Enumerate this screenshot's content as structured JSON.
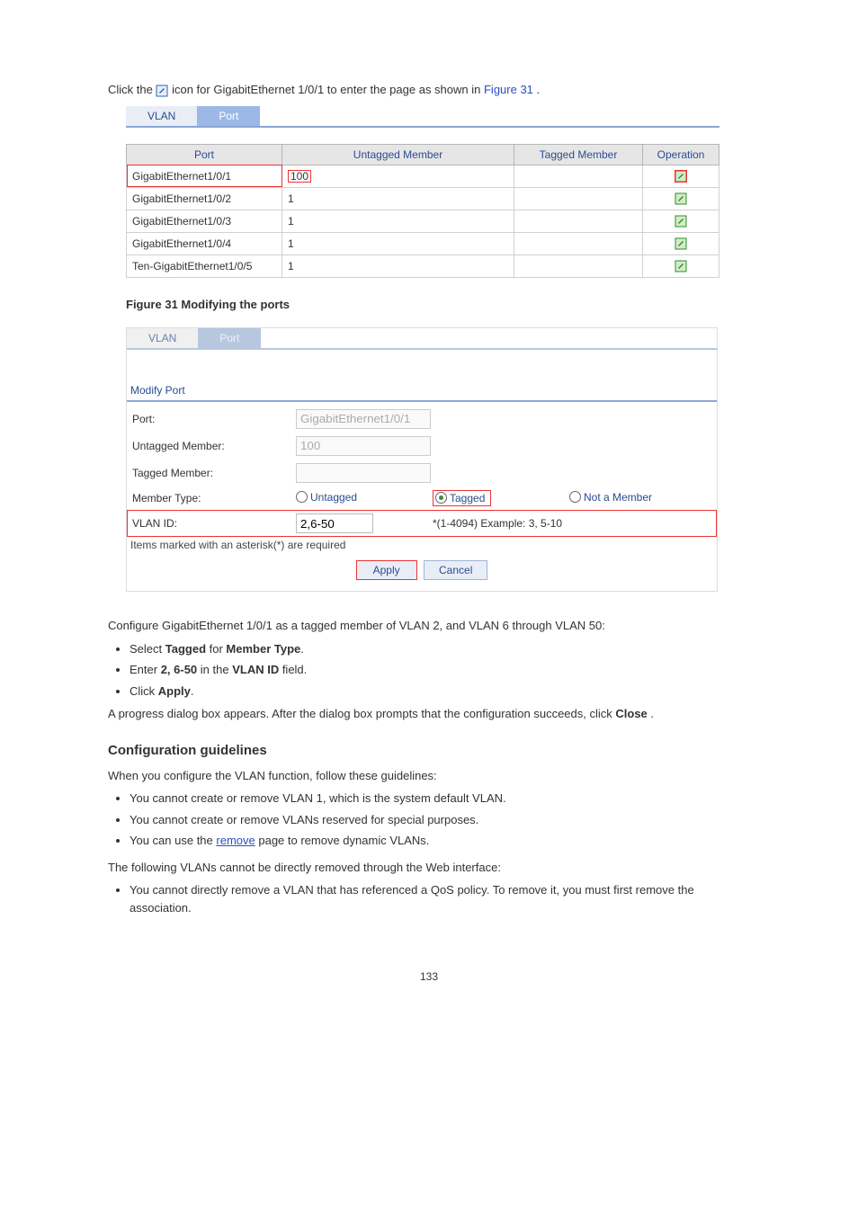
{
  "intro_line1_a": "Click the ",
  "intro_line1_b": " icon for GigabitEthernet 1/0/1 to enter the page as shown in ",
  "intro_line1_ref": "Figure 31",
  "intro_line1_c": ".",
  "tabs": {
    "vlan": "VLAN",
    "port": "Port"
  },
  "table1": {
    "headers": [
      "Port",
      "Untagged Member",
      "Tagged Member",
      "Operation"
    ],
    "rows": [
      {
        "port": "GigabitEthernet1/0/1",
        "untagged": "100",
        "tagged": ""
      },
      {
        "port": "GigabitEthernet1/0/2",
        "untagged": "1",
        "tagged": ""
      },
      {
        "port": "GigabitEthernet1/0/3",
        "untagged": "1",
        "tagged": ""
      },
      {
        "port": "GigabitEthernet1/0/4",
        "untagged": "1",
        "tagged": ""
      },
      {
        "port": "Ten-GigabitEthernet1/0/5",
        "untagged": "1",
        "tagged": ""
      }
    ]
  },
  "figure31": "Figure 31 Modifying the ports",
  "modify": {
    "title": "Modify Port",
    "labels": {
      "port": "Port:",
      "untagged": "Untagged Member:",
      "tagged": "Tagged Member:",
      "member_type": "Member Type:",
      "vlan_id": "VLAN ID:"
    },
    "values": {
      "port": "GigabitEthernet1/0/1",
      "untagged": "100",
      "tagged": "",
      "vlan_id": "2,6-50"
    },
    "radios": {
      "untagged": "Untagged",
      "tagged": "Tagged",
      "not_member": "Not a Member"
    },
    "vlan_hint": "*(1-4094) Example: 3, 5-10",
    "required_hint": "Items marked with an asterisk(*) are required",
    "apply": "Apply",
    "cancel": "Cancel"
  },
  "below_figure_line": "Configure GigabitEthernet 1/0/1 as a tagged member of VLAN 2, and VLAN 6 through VLAN 50:",
  "bullets1": [
    {
      "a": "Select ",
      "b": "Tagged",
      "c": " for ",
      "d": "Member Type",
      "e": "."
    },
    {
      "a": "Enter ",
      "b": "2, 6-50",
      "c": " in the ",
      "d": "VLAN ID",
      "e": " field."
    },
    {
      "a": "Click ",
      "b": "Apply",
      "c": ". ",
      "d": "",
      "e": ""
    }
  ],
  "after1_a": "A progress dialog box appears. After the dialog box prompts that the configuration succeeds, click ",
  "after1_b": "Close",
  "after1_c": ".",
  "h3": "Configuration guidelines",
  "guidelines_intro": "When you configure the VLAN function, follow these guidelines:",
  "guidelines": [
    "You cannot create or remove VLAN 1, which is the system default VLAN.",
    "You cannot create or remove VLANs reserved for special purposes.",
    {
      "a": "You can use the ",
      "b": "remove",
      "c": " page to remove dynamic VLANs."
    }
  ],
  "following_note": "The following VLANs cannot be directly removed through the Web interface:",
  "bullets2": [
    "You cannot directly remove a VLAN that has referenced a QoS policy. To remove it, you must first remove the association."
  ],
  "pager": "133"
}
